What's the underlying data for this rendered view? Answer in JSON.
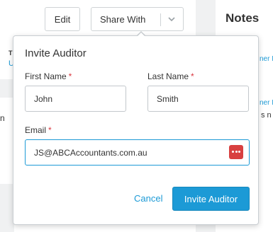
{
  "toolbar": {
    "edit_label": "Edit",
    "share_label": "Share With"
  },
  "notes_panel": {
    "title": "Notes",
    "link_1": "ner I",
    "link_2": "ner I",
    "text_1": "s n"
  },
  "background": {
    "fragment_t": "T",
    "fragment_u": "U",
    "fragment_n": "n"
  },
  "invite_form": {
    "title": "Invite Auditor",
    "required_mark": "*",
    "first_name": {
      "label": "First Name",
      "value": "John"
    },
    "last_name": {
      "label": "Last Name",
      "value": "Smith"
    },
    "email": {
      "label": "Email",
      "value": "JS@ABCAccountants.com.au"
    },
    "cancel_label": "Cancel",
    "submit_label": "Invite Auditor"
  },
  "colors": {
    "accent": "#1c9ad6",
    "required": "#d9363e",
    "password_manager_icon": "#d84040",
    "page_gutter": "#f0f1f2"
  },
  "icons": {
    "dropdown": "chevron-down-icon",
    "password_manager": "password-manager-icon"
  }
}
